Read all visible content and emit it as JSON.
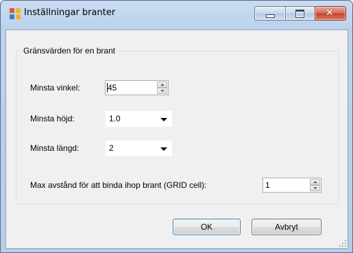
{
  "window": {
    "title": "Inställningar branter",
    "icon": "app-window-icon",
    "controls": {
      "minimize": "minimize-icon",
      "maximize": "maximize-icon",
      "close": "close-icon"
    },
    "colors": {
      "close_accent": "#c5412a",
      "frame": "#b6cde8"
    }
  },
  "group": {
    "legend": "Gränsvärden för en brant",
    "fields": {
      "min_angle": {
        "label": "Minsta vinkel:",
        "value": "45"
      },
      "min_height": {
        "label": "Minsta höjd:",
        "value": "1.0"
      },
      "min_length": {
        "label": "Minsta längd:",
        "value": "2"
      },
      "max_distance": {
        "label": "Max avstånd för att binda ihop brant (GRID cell):",
        "value": "1"
      }
    }
  },
  "buttons": {
    "ok": "OK",
    "cancel": "Avbryt"
  }
}
